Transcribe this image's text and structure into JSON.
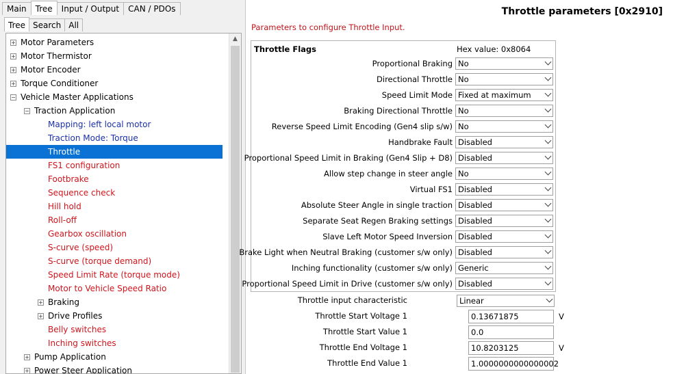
{
  "main_tabs": [
    "Main",
    "Tree",
    "Input / Output",
    "CAN / PDOs"
  ],
  "sub_tabs": [
    "Tree",
    "Search",
    "All"
  ],
  "tree": [
    {
      "label": "Motor Parameters",
      "level": 0,
      "expander": "plus",
      "color": "black"
    },
    {
      "label": "Motor Thermistor",
      "level": 0,
      "expander": "plus",
      "color": "black"
    },
    {
      "label": "Motor Encoder",
      "level": 0,
      "expander": "plus",
      "color": "black"
    },
    {
      "label": "Torque Conditioner",
      "level": 0,
      "expander": "plus",
      "color": "black"
    },
    {
      "label": "Vehicle Master Applications",
      "level": 0,
      "expander": "minus",
      "color": "black"
    },
    {
      "label": "Traction Application",
      "level": 1,
      "expander": "minus",
      "color": "black"
    },
    {
      "label": "Mapping: left local motor",
      "level": 2,
      "expander": "",
      "color": "blue"
    },
    {
      "label": "Traction Mode: Torque",
      "level": 2,
      "expander": "",
      "color": "blue"
    },
    {
      "label": "Throttle",
      "level": 2,
      "expander": "",
      "color": "black",
      "selected": true
    },
    {
      "label": "FS1 configuration",
      "level": 2,
      "expander": "",
      "color": "red"
    },
    {
      "label": "Footbrake",
      "level": 2,
      "expander": "",
      "color": "red"
    },
    {
      "label": "Sequence check",
      "level": 2,
      "expander": "",
      "color": "red"
    },
    {
      "label": "Hill hold",
      "level": 2,
      "expander": "",
      "color": "red"
    },
    {
      "label": "Roll-off",
      "level": 2,
      "expander": "",
      "color": "red"
    },
    {
      "label": "Gearbox oscillation",
      "level": 2,
      "expander": "",
      "color": "red"
    },
    {
      "label": "S-curve (speed)",
      "level": 2,
      "expander": "",
      "color": "red"
    },
    {
      "label": "S-curve (torque demand)",
      "level": 2,
      "expander": "",
      "color": "red"
    },
    {
      "label": "Speed Limit Rate (torque mode)",
      "level": 2,
      "expander": "",
      "color": "red"
    },
    {
      "label": "Motor to Vehicle Speed Ratio",
      "level": 2,
      "expander": "",
      "color": "red"
    },
    {
      "label": "Braking",
      "level": 2,
      "expander": "plus",
      "color": "black"
    },
    {
      "label": "Drive Profiles",
      "level": 2,
      "expander": "plus",
      "color": "black"
    },
    {
      "label": "Belly switches",
      "level": 2,
      "expander": "",
      "color": "red"
    },
    {
      "label": "Inching switches",
      "level": 2,
      "expander": "",
      "color": "red"
    },
    {
      "label": "Pump Application",
      "level": 1,
      "expander": "plus",
      "color": "black"
    },
    {
      "label": "Power Steer Application",
      "level": 1,
      "expander": "plus",
      "color": "black"
    }
  ],
  "page": {
    "title": "Throttle parameters [0x2910]",
    "subtitle": "Parameters to configure Throttle Input."
  },
  "flags": {
    "title": "Throttle Flags",
    "hex_value": "Hex value: 0x8064",
    "rows": [
      {
        "label": "Proportional Braking",
        "value": "No"
      },
      {
        "label": "Directional Throttle",
        "value": "No"
      },
      {
        "label": "Speed Limit Mode",
        "value": "Fixed at maximum"
      },
      {
        "label": "Braking Directional Throttle",
        "value": "No"
      },
      {
        "label": "Reverse Speed Limit Encoding (Gen4 slip s/w)",
        "value": "No"
      },
      {
        "label": "Handbrake Fault",
        "value": "Disabled"
      },
      {
        "label": "Proportional Speed Limit in Braking (Gen4 Slip + D8)",
        "value": "Disabled"
      },
      {
        "label": "Allow step change in steer angle",
        "value": "No"
      },
      {
        "label": "Virtual FS1",
        "value": "Disabled"
      },
      {
        "label": "Absolute Steer Angle in single traction",
        "value": "Disabled"
      },
      {
        "label": "Separate Seat Regen Braking settings",
        "value": "Disabled"
      },
      {
        "label": "Slave Left Motor Speed Inversion",
        "value": "Disabled"
      },
      {
        "label": "Brake Light when Neutral Braking  (customer s/w only)",
        "value": "Disabled"
      },
      {
        "label": "Inching functionality (customer s/w only)",
        "value": "Generic"
      },
      {
        "label": "Proportional Speed Limit in Drive (customer s/w only)",
        "value": "Disabled"
      }
    ]
  },
  "params": [
    {
      "label": "Throttle input characteristic",
      "kind": "select",
      "value": "Linear",
      "unit": ""
    },
    {
      "label": "Throttle Start Voltage 1",
      "kind": "text",
      "value": "0.13671875",
      "unit": "V"
    },
    {
      "label": "Throttle Start Value 1",
      "kind": "text",
      "value": "0.0",
      "unit": ""
    },
    {
      "label": "Throttle End Voltage 1",
      "kind": "text",
      "value": "10.8203125",
      "unit": "V"
    },
    {
      "label": "Throttle End Value 1",
      "kind": "text",
      "value": "1.0000000000000002",
      "unit": ""
    }
  ],
  "colors": {
    "selection": "#0a72d4",
    "red_text": "#d0141b",
    "blue_text": "#1a2fa8"
  }
}
